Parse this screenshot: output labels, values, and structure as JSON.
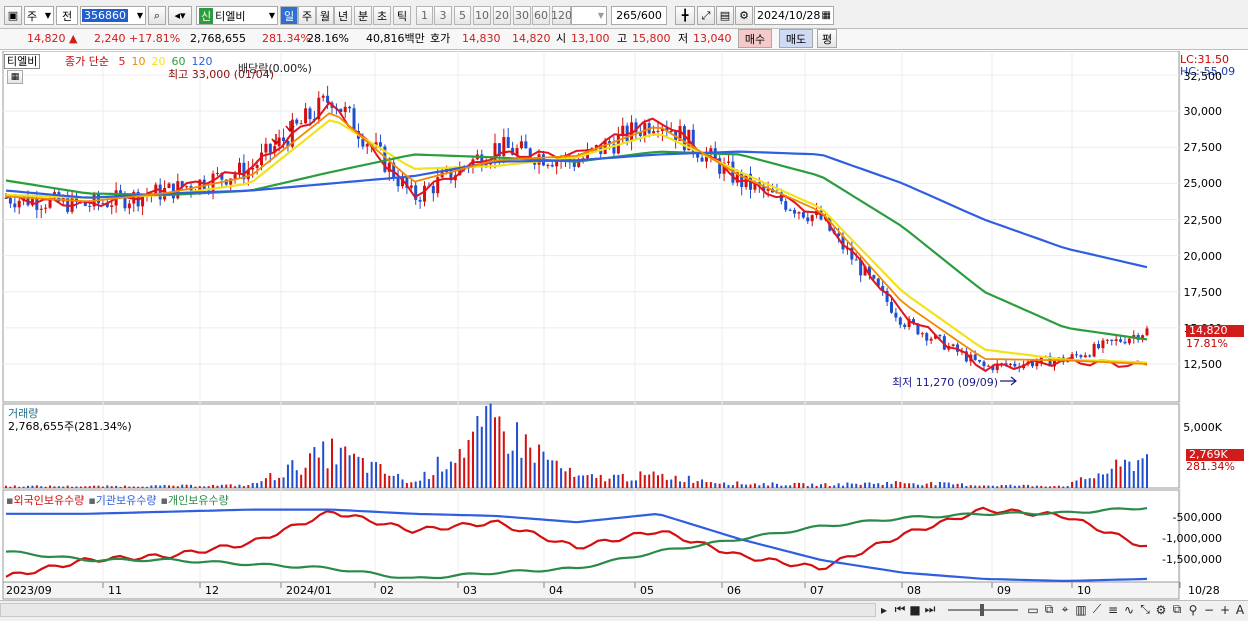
{
  "toolbar": {
    "type_label": "주",
    "all_label": "전",
    "code": "356860",
    "name_badge": "신",
    "stock_name": "티엘비",
    "period_buttons": [
      "일",
      "주",
      "월",
      "년",
      "분",
      "초",
      "틱"
    ],
    "period_selected": "일",
    "interval_buttons": [
      "1",
      "3",
      "5",
      "10",
      "20",
      "30",
      "60",
      "120"
    ],
    "count": "265",
    "count_max": "/600",
    "date": "2024/10/28"
  },
  "quote": {
    "price": "14,820",
    "change_arrow": "▲",
    "change": "2,240",
    "change_pct": "+17.81%",
    "volume": "2,768,655",
    "vol_ratio": "281.34%",
    "turnover_pct": "28.16%",
    "amount": "40,816백만",
    "ask_label": "호가",
    "ask": "14,830",
    "bid": "14,820",
    "open_label": "시",
    "open": "13,100",
    "high_label": "고",
    "high": "15,800",
    "low_label": "저",
    "low": "13,040",
    "buy_button": "매수",
    "sell_button": "매도",
    "eval_button": "평"
  },
  "price_panel": {
    "name_tag": "티엘비",
    "ma_label": "종가 단순",
    "ma_periods": [
      "5",
      "10",
      "20",
      "60",
      "120"
    ],
    "ma_colors": [
      "#e0141e",
      "#f28a00",
      "#f0e31a",
      "#2a9d3c",
      "#2f5fe0"
    ],
    "lc": "LC:31.50",
    "hc": "HC:-55.09",
    "high_annotation": "최고 33,000 (01/04)",
    "dividend_annotation": "배당락(0.00%)",
    "low_annotation": "최저 11,270 (09/09)",
    "price_tag": "14,820",
    "pct_tag": "17.81%",
    "y_ticks": [
      "32,500",
      "30,000",
      "27,500",
      "25,000",
      "22,500",
      "20,000",
      "17,500",
      "15,000",
      "12,500"
    ]
  },
  "volume_panel": {
    "title": "거래량",
    "value": "2,768,655주(281.34%)",
    "y_ticks": [
      "5,000K",
      "0"
    ],
    "tag": "2,769K",
    "tag_pct": "281.34%"
  },
  "holding_panel": {
    "legend": [
      "외국인보유수량",
      "기관보유수량",
      "개인보유수량"
    ],
    "legend_colors": [
      "#d40f0f",
      "#2f5fe0",
      "#2a8a4a"
    ],
    "y_ticks": [
      "-500,000",
      "-1,000,000",
      "-1,500,000"
    ]
  },
  "x_axis": [
    "2023/09",
    "11",
    "12",
    "2024/01",
    "02",
    "03",
    "04",
    "05",
    "06",
    "07",
    "08",
    "09",
    "10",
    "10/28"
  ],
  "chart_data": {
    "type": "candlestick",
    "title": "",
    "xlabel": "",
    "ylabel": "",
    "ylim": [
      11000,
      33500
    ],
    "x": [
      "2023/09",
      "2023/10",
      "2023/11",
      "2023/12",
      "2024/01",
      "2024/02",
      "2024/03",
      "2024/04",
      "2024/05",
      "2024/06",
      "2024/07",
      "2024/08",
      "2024/09",
      "2024/10",
      "2024/10/28"
    ],
    "close_approx": [
      24000,
      23500,
      24500,
      26000,
      31000,
      24000,
      27500,
      26500,
      29500,
      25200,
      22500,
      15500,
      12300,
      12800,
      14820
    ],
    "series": [
      {
        "name": "5",
        "values": [
          24000,
          23500,
          24500,
          26000,
          30500,
          24200,
          27000,
          27000,
          29500,
          25300,
          22800,
          16000,
          12200,
          12700,
          12400
        ]
      },
      {
        "name": "20",
        "values": [
          24200,
          24000,
          24200,
          25000,
          29500,
          26000,
          26200,
          26800,
          28500,
          25800,
          23300,
          17500,
          13500,
          12800,
          12600
        ]
      },
      {
        "name": "60",
        "values": [
          25200,
          24300,
          24200,
          24500,
          25800,
          27000,
          26800,
          26500,
          27200,
          27000,
          25500,
          22000,
          17500,
          15000,
          14200
        ]
      },
      {
        "name": "120",
        "values": [
          24500,
          24000,
          24300,
          24500,
          25000,
          25500,
          26500,
          26600,
          27000,
          27200,
          27000,
          25000,
          22500,
          20500,
          19200
        ]
      }
    ],
    "volume_k": [
      180,
      160,
      200,
      260,
      3300,
      400,
      5800,
      900,
      1100,
      400,
      300,
      500,
      250,
      200,
      2769
    ],
    "holdings": {
      "외국인보유수량": [
        -1900000,
        -1500000,
        -1400000,
        -1100000,
        -350000,
        -800000,
        -600000,
        -1200000,
        -800000,
        -1400000,
        -1700000,
        -900000,
        -300000,
        -450000,
        -1200000
      ],
      "기관보유수량": [
        -400000,
        -400000,
        -350000,
        -300000,
        -300000,
        -400000,
        -450000,
        -600000,
        -400000,
        -1000000,
        -1500000,
        -1800000,
        -1950000,
        -2000000,
        -1950000
      ],
      "개인보유수량": [
        -1300000,
        -1500000,
        -1500000,
        -1600000,
        -1700000,
        -1950000,
        -1800000,
        -1700000,
        -1300000,
        -1000000,
        -700000,
        -500000,
        -400000,
        -380000,
        -250000
      ]
    }
  }
}
